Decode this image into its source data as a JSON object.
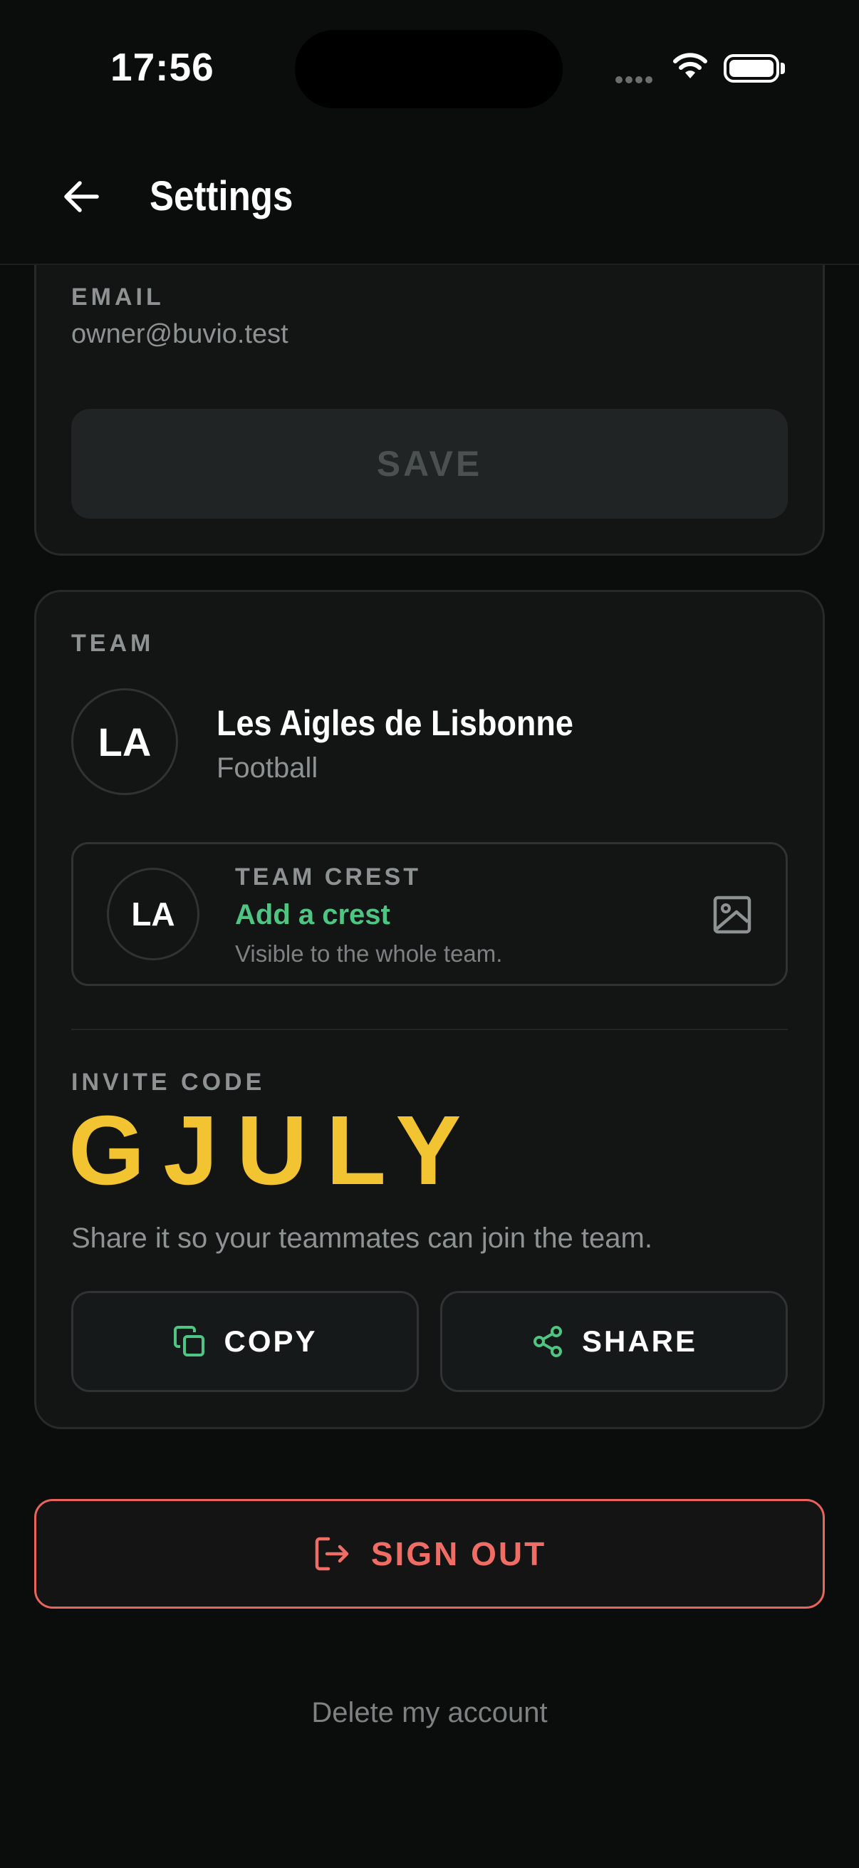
{
  "status_bar": {
    "time": "17:56"
  },
  "header": {
    "title": "Settings"
  },
  "account": {
    "email_label": "EMAIL",
    "email_value": "owner@buvio.test",
    "save_label": "SAVE"
  },
  "team": {
    "section_label": "TEAM",
    "initials": "LA",
    "name": "Les Aigles de Lisbonne",
    "sport": "Football",
    "crest": {
      "label": "TEAM CREST",
      "initials": "LA",
      "action": "Add a crest",
      "hint": "Visible to the whole team."
    },
    "invite": {
      "label": "INVITE CODE",
      "code": "GJULY",
      "hint": "Share it so your teammates can join the team.",
      "copy_label": "COPY",
      "share_label": "SHARE"
    }
  },
  "signout_label": "SIGN OUT",
  "delete_account_label": "Delete my account",
  "colors": {
    "accent_green": "#4fc583",
    "invite_yellow": "#f3c431",
    "danger_red": "#f06d66"
  },
  "icons": [
    "back-arrow-icon",
    "wifi-icon",
    "battery-icon",
    "image-icon",
    "copy-icon",
    "share-icon",
    "sign-out-icon"
  ]
}
